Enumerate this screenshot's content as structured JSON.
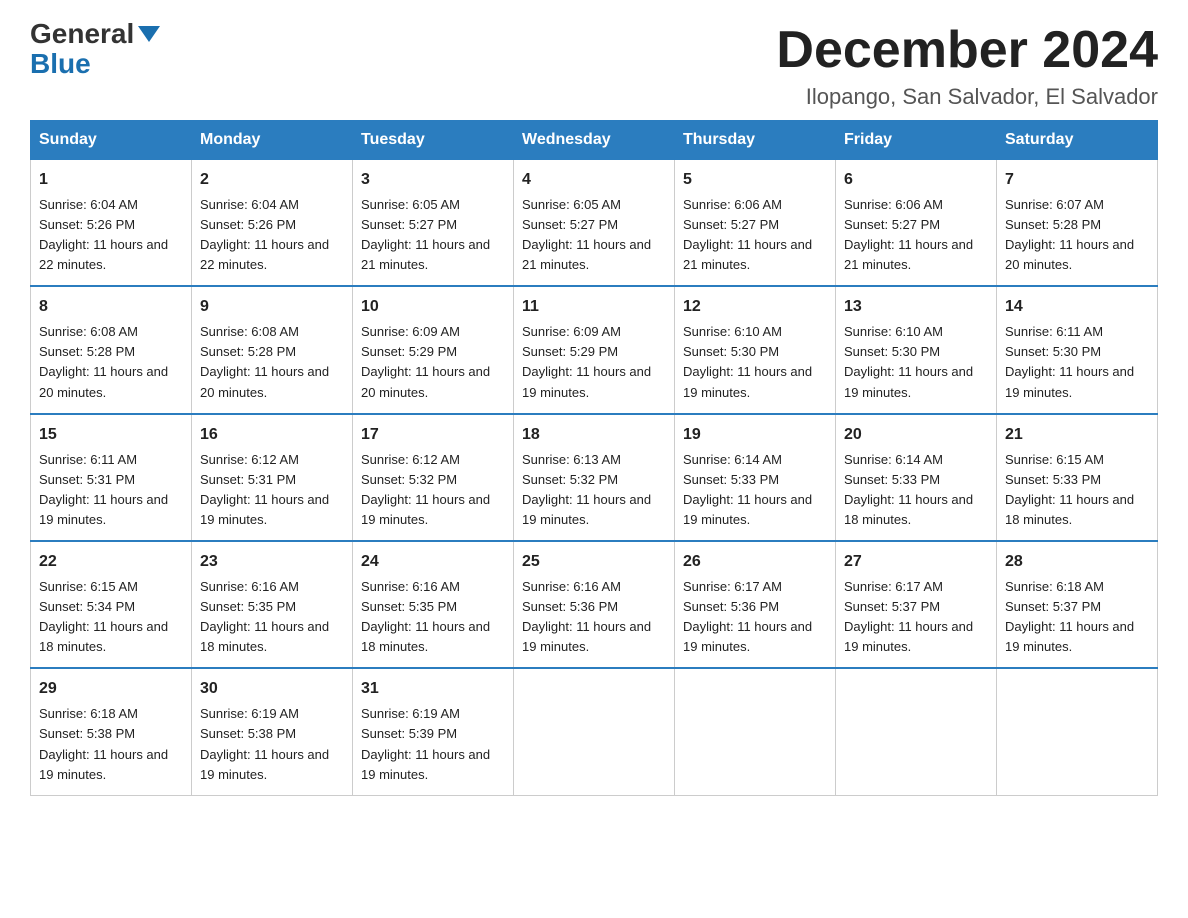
{
  "header": {
    "logo_line1": "General",
    "logo_line2": "Blue",
    "month_title": "December 2024",
    "location": "Ilopango, San Salvador, El Salvador"
  },
  "weekdays": [
    "Sunday",
    "Monday",
    "Tuesday",
    "Wednesday",
    "Thursday",
    "Friday",
    "Saturday"
  ],
  "weeks": [
    [
      {
        "day": "1",
        "sunrise": "6:04 AM",
        "sunset": "5:26 PM",
        "daylight": "11 hours and 22 minutes."
      },
      {
        "day": "2",
        "sunrise": "6:04 AM",
        "sunset": "5:26 PM",
        "daylight": "11 hours and 22 minutes."
      },
      {
        "day": "3",
        "sunrise": "6:05 AM",
        "sunset": "5:27 PM",
        "daylight": "11 hours and 21 minutes."
      },
      {
        "day": "4",
        "sunrise": "6:05 AM",
        "sunset": "5:27 PM",
        "daylight": "11 hours and 21 minutes."
      },
      {
        "day": "5",
        "sunrise": "6:06 AM",
        "sunset": "5:27 PM",
        "daylight": "11 hours and 21 minutes."
      },
      {
        "day": "6",
        "sunrise": "6:06 AM",
        "sunset": "5:27 PM",
        "daylight": "11 hours and 21 minutes."
      },
      {
        "day": "7",
        "sunrise": "6:07 AM",
        "sunset": "5:28 PM",
        "daylight": "11 hours and 20 minutes."
      }
    ],
    [
      {
        "day": "8",
        "sunrise": "6:08 AM",
        "sunset": "5:28 PM",
        "daylight": "11 hours and 20 minutes."
      },
      {
        "day": "9",
        "sunrise": "6:08 AM",
        "sunset": "5:28 PM",
        "daylight": "11 hours and 20 minutes."
      },
      {
        "day": "10",
        "sunrise": "6:09 AM",
        "sunset": "5:29 PM",
        "daylight": "11 hours and 20 minutes."
      },
      {
        "day": "11",
        "sunrise": "6:09 AM",
        "sunset": "5:29 PM",
        "daylight": "11 hours and 19 minutes."
      },
      {
        "day": "12",
        "sunrise": "6:10 AM",
        "sunset": "5:30 PM",
        "daylight": "11 hours and 19 minutes."
      },
      {
        "day": "13",
        "sunrise": "6:10 AM",
        "sunset": "5:30 PM",
        "daylight": "11 hours and 19 minutes."
      },
      {
        "day": "14",
        "sunrise": "6:11 AM",
        "sunset": "5:30 PM",
        "daylight": "11 hours and 19 minutes."
      }
    ],
    [
      {
        "day": "15",
        "sunrise": "6:11 AM",
        "sunset": "5:31 PM",
        "daylight": "11 hours and 19 minutes."
      },
      {
        "day": "16",
        "sunrise": "6:12 AM",
        "sunset": "5:31 PM",
        "daylight": "11 hours and 19 minutes."
      },
      {
        "day": "17",
        "sunrise": "6:12 AM",
        "sunset": "5:32 PM",
        "daylight": "11 hours and 19 minutes."
      },
      {
        "day": "18",
        "sunrise": "6:13 AM",
        "sunset": "5:32 PM",
        "daylight": "11 hours and 19 minutes."
      },
      {
        "day": "19",
        "sunrise": "6:14 AM",
        "sunset": "5:33 PM",
        "daylight": "11 hours and 19 minutes."
      },
      {
        "day": "20",
        "sunrise": "6:14 AM",
        "sunset": "5:33 PM",
        "daylight": "11 hours and 18 minutes."
      },
      {
        "day": "21",
        "sunrise": "6:15 AM",
        "sunset": "5:33 PM",
        "daylight": "11 hours and 18 minutes."
      }
    ],
    [
      {
        "day": "22",
        "sunrise": "6:15 AM",
        "sunset": "5:34 PM",
        "daylight": "11 hours and 18 minutes."
      },
      {
        "day": "23",
        "sunrise": "6:16 AM",
        "sunset": "5:35 PM",
        "daylight": "11 hours and 18 minutes."
      },
      {
        "day": "24",
        "sunrise": "6:16 AM",
        "sunset": "5:35 PM",
        "daylight": "11 hours and 18 minutes."
      },
      {
        "day": "25",
        "sunrise": "6:16 AM",
        "sunset": "5:36 PM",
        "daylight": "11 hours and 19 minutes."
      },
      {
        "day": "26",
        "sunrise": "6:17 AM",
        "sunset": "5:36 PM",
        "daylight": "11 hours and 19 minutes."
      },
      {
        "day": "27",
        "sunrise": "6:17 AM",
        "sunset": "5:37 PM",
        "daylight": "11 hours and 19 minutes."
      },
      {
        "day": "28",
        "sunrise": "6:18 AM",
        "sunset": "5:37 PM",
        "daylight": "11 hours and 19 minutes."
      }
    ],
    [
      {
        "day": "29",
        "sunrise": "6:18 AM",
        "sunset": "5:38 PM",
        "daylight": "11 hours and 19 minutes."
      },
      {
        "day": "30",
        "sunrise": "6:19 AM",
        "sunset": "5:38 PM",
        "daylight": "11 hours and 19 minutes."
      },
      {
        "day": "31",
        "sunrise": "6:19 AM",
        "sunset": "5:39 PM",
        "daylight": "11 hours and 19 minutes."
      },
      null,
      null,
      null,
      null
    ]
  ],
  "labels": {
    "sunrise": "Sunrise:",
    "sunset": "Sunset:",
    "daylight": "Daylight:"
  }
}
